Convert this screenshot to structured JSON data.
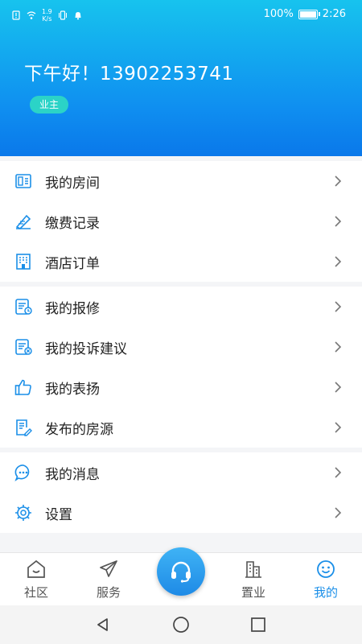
{
  "status_bar": {
    "network_speed": "1.9\nK/s",
    "battery_percent": "100%",
    "time": "2:26"
  },
  "profile": {
    "greeting": "下午好！13902253741",
    "role_badge": "业主"
  },
  "menu_groups": [
    [
      {
        "label": "我的房间",
        "icon": "room-icon"
      },
      {
        "label": "缴费记录",
        "icon": "payment-record-icon"
      },
      {
        "label": "酒店订单",
        "icon": "hotel-icon"
      }
    ],
    [
      {
        "label": "我的报修",
        "icon": "repair-icon"
      },
      {
        "label": "我的投诉建议",
        "icon": "complaint-icon"
      },
      {
        "label": "我的表扬",
        "icon": "thumbs-up-icon"
      },
      {
        "label": "发布的房源",
        "icon": "listing-icon"
      }
    ],
    [
      {
        "label": "我的消息",
        "icon": "message-icon"
      },
      {
        "label": "设置",
        "icon": "settings-icon"
      }
    ]
  ],
  "tabbar": {
    "items": [
      {
        "label": "社区",
        "icon": "community-icon"
      },
      {
        "label": "服务",
        "icon": "paper-plane-icon"
      },
      {
        "label": "置业",
        "icon": "buildings-icon"
      },
      {
        "label": "我的",
        "icon": "smiley-icon"
      }
    ],
    "center_icon": "headset-icon",
    "active": "我的"
  },
  "colors": {
    "accent": "#1b8fe8",
    "header_top": "#17c3ee",
    "header_bottom": "#0a78ea",
    "badge": "#2bd3c7"
  }
}
